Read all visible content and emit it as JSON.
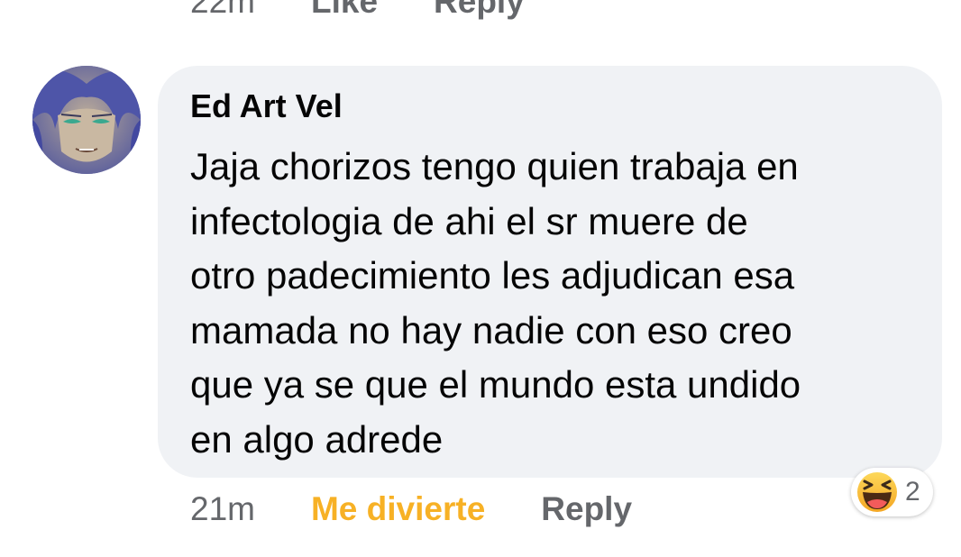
{
  "previous_comment": {
    "time": "22m",
    "like_label": "Like",
    "reply_label": "Reply"
  },
  "comment": {
    "author": "Ed Art Vel",
    "text_lines": [
      "Jaja chorizos tengo quien trabaja en",
      "infectologia de ahi el sr muere de",
      "otro padecimiento les adjudican esa",
      "mamada no hay nadie con eso creo",
      "que ya se que el mundo esta undido",
      "en algo adrede"
    ],
    "time": "21m",
    "reaction_label": "Me divierte",
    "reply_label": "Reply",
    "reaction_count": "2",
    "reaction_icon": "haha-laughing-emoji-icon"
  },
  "colors": {
    "bubble": "#f0f2f5",
    "text": "#050505",
    "secondary": "#65676b",
    "haha_reaction": "#f7b125"
  }
}
